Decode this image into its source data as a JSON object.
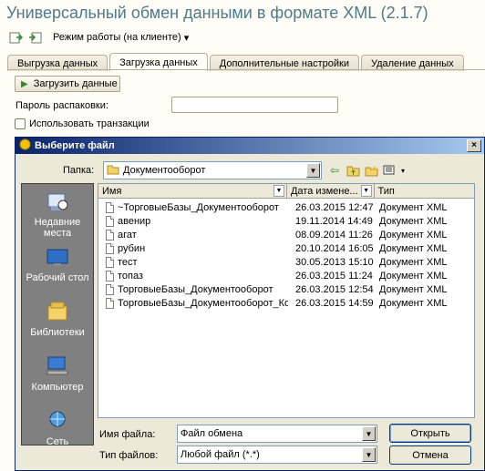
{
  "app": {
    "title": "Универсальный обмен данными в формате XML (2.1.7)"
  },
  "toolbar": {
    "mode_label": "Режим работы (на клиенте)",
    "icons": [
      "export-icon",
      "import-icon"
    ]
  },
  "tabs": [
    {
      "label": "Выгрузка данных",
      "active": false
    },
    {
      "label": "Загрузка данных",
      "active": true
    },
    {
      "label": "Дополнительные настройки",
      "active": false
    },
    {
      "label": "Удаление данных",
      "active": false
    }
  ],
  "load_panel": {
    "load_button": "Загрузить данные",
    "password_label": "Пароль распаковки:",
    "password_value": "",
    "transactions_label": "Использовать транзакции",
    "transactions_checked": false
  },
  "dialog": {
    "title": "Выберите файл",
    "look_in_label": "Папка:",
    "look_in_value": "Документооборот",
    "places": [
      {
        "label": "Недавние места",
        "icon": "recent-places-icon"
      },
      {
        "label": "Рабочий стол",
        "icon": "desktop-icon"
      },
      {
        "label": "Библиотеки",
        "icon": "libraries-icon"
      },
      {
        "label": "Компьютер",
        "icon": "computer-icon"
      },
      {
        "label": "Сеть",
        "icon": "network-icon"
      }
    ],
    "columns": {
      "name": "Имя",
      "date": "Дата измене...",
      "type": "Тип"
    },
    "files": [
      {
        "name": "~ТорговыеБазы_Документооборот",
        "date": "26.03.2015 12:47",
        "type": "Документ XML"
      },
      {
        "name": "авенир",
        "date": "19.11.2014 14:49",
        "type": "Документ XML"
      },
      {
        "name": "агат",
        "date": "08.09.2014 11:26",
        "type": "Документ XML"
      },
      {
        "name": "рубин",
        "date": "20.10.2014 16:05",
        "type": "Документ XML"
      },
      {
        "name": "тест",
        "date": "30.05.2013 15:10",
        "type": "Документ XML"
      },
      {
        "name": "топаз",
        "date": "26.03.2015 11:24",
        "type": "Документ XML"
      },
      {
        "name": "ТорговыеБазы_Документооборот",
        "date": "26.03.2015 12:54",
        "type": "Документ XML"
      },
      {
        "name": "ТорговыеБазы_Документооборот_Копия",
        "date": "26.03.2015 14:59",
        "type": "Документ XML"
      }
    ],
    "file_name_label": "Имя файла:",
    "file_name_value": "Файл обмена",
    "file_type_label": "Тип файлов:",
    "file_type_value": "Любой файл (*.*)",
    "open_button": "Открыть",
    "cancel_button": "Отмена"
  }
}
